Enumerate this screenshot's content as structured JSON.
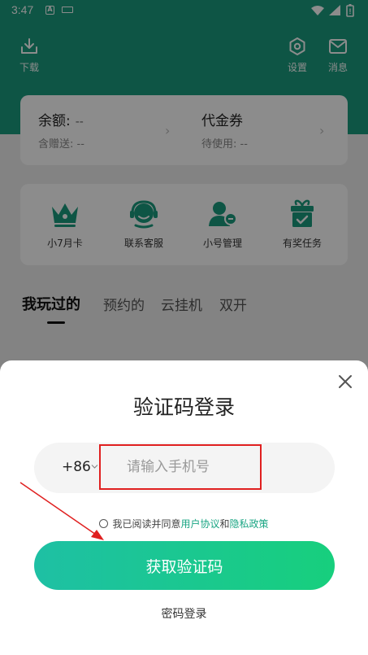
{
  "status_bar": {
    "time": "3:47",
    "notif_letter": "A"
  },
  "header": {
    "download_label": "下载",
    "settings_label": "设置",
    "messages_label": "消息"
  },
  "balance_card": {
    "balance_title": "余额:",
    "balance_value": "--",
    "balance_sub": "含赠送: --",
    "voucher_title": "代金券",
    "voucher_sub": "待使用: --"
  },
  "shortcuts": [
    {
      "label": "小7月卡",
      "icon": "crown-icon"
    },
    {
      "label": "联系客服",
      "icon": "customer-service-icon"
    },
    {
      "label": "小号管理",
      "icon": "account-management-icon"
    },
    {
      "label": "有奖任务",
      "icon": "gift-task-icon"
    }
  ],
  "tabs": [
    {
      "label": "我玩过的",
      "active": true
    },
    {
      "label": "预约的",
      "active": false
    },
    {
      "label": "云挂机",
      "active": false
    },
    {
      "label": "双开",
      "active": false
    }
  ],
  "login_sheet": {
    "title": "验证码登录",
    "country_code": "+86",
    "phone_placeholder": "请输入手机号",
    "agree_prefix": "我已阅读并同意",
    "user_agreement": "用户协议",
    "and": "和",
    "privacy_policy": "隐私政策",
    "submit_label": "获取验证码",
    "password_login": "密码登录"
  },
  "colors": {
    "brand_teal": "#1a9c7f",
    "button_gradient_start": "#1ec0a4",
    "button_gradient_end": "#17cf7d",
    "link": "#19a583",
    "annotation_red": "#e02020"
  }
}
